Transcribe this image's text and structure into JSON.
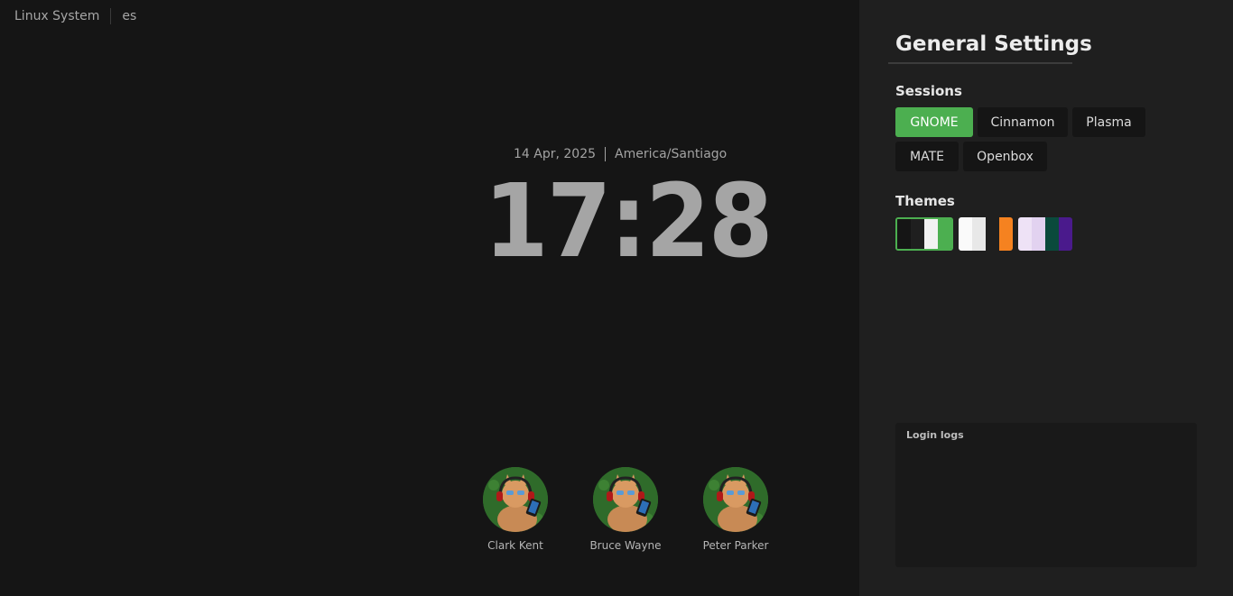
{
  "topbar": {
    "system_name": "Linux System",
    "language": "es"
  },
  "clock": {
    "date": "14 Apr, 2025",
    "timezone": "America/Santiago",
    "time": "17:28"
  },
  "users": [
    {
      "name": "Clark Kent",
      "avatar_icon": "cat-with-headphones-avatar"
    },
    {
      "name": "Bruce Wayne",
      "avatar_icon": "cat-with-headphones-avatar"
    },
    {
      "name": "Peter Parker",
      "avatar_icon": "cat-with-headphones-avatar"
    }
  ],
  "settings": {
    "title": "General Settings",
    "sessions_label": "Sessions",
    "sessions": [
      {
        "label": "GNOME",
        "active": true
      },
      {
        "label": "Cinnamon",
        "active": false
      },
      {
        "label": "Plasma",
        "active": false
      },
      {
        "label": "MATE",
        "active": false
      },
      {
        "label": "Openbox",
        "active": false
      }
    ],
    "themes_label": "Themes",
    "themes": [
      {
        "colors": [
          "#151515",
          "#1f1f1f",
          "#f2f2f2",
          "#4caf50"
        ],
        "selected": true
      },
      {
        "colors": [
          "#fafafa",
          "#e8e8e8",
          "#1f1f1f",
          "#f58220"
        ],
        "selected": false
      },
      {
        "colors": [
          "#eee2f6",
          "#e2d2f0",
          "#0a4a3c",
          "#4a1a8c"
        ],
        "selected": false
      }
    ],
    "logs_label": "Login logs"
  },
  "colors": {
    "accent": "#4caf50",
    "background": "#151515",
    "panel": "#1f1f1f"
  }
}
